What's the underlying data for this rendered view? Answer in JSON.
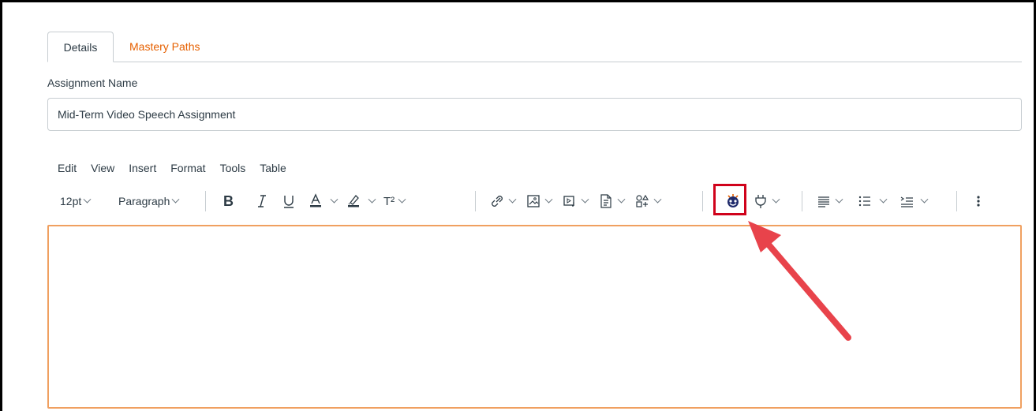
{
  "tabs": {
    "details_label": "Details",
    "mastery_label": "Mastery Paths"
  },
  "assignment": {
    "label": "Assignment Name",
    "value": "Mid-Term Video Speech Assignment"
  },
  "editor_menu": [
    "Edit",
    "View",
    "Insert",
    "Format",
    "Tools",
    "Table"
  ],
  "toolbar": {
    "font_size": "12pt",
    "block_format": "Paragraph",
    "superscript_icon_text": "T²"
  },
  "colors": {
    "accent_orange": "#e66000",
    "editor_border": "#f0a060",
    "annotation_red": "#d0021b",
    "text_dark": "#2d3b45"
  },
  "icons": [
    "bold-icon",
    "italic-icon",
    "underline-icon",
    "text-color-icon",
    "highlight-icon",
    "superscript-icon",
    "link-icon",
    "image-icon",
    "media-icon",
    "document-icon",
    "apps-icon",
    "video-tool-icon",
    "plugin-icon",
    "align-icon",
    "bullet-list-icon",
    "indent-icon",
    "more-icon"
  ]
}
